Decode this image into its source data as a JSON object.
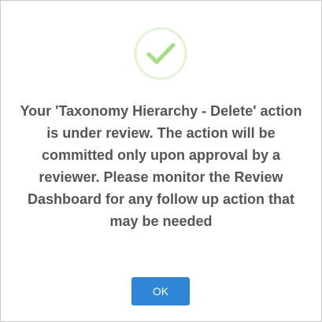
{
  "dialog": {
    "icon": "check-icon",
    "icon_color": "#a5dc86",
    "message": "Your 'Taxonomy Hierarchy - Delete' action is under review. The action will be committed only upon approval by a reviewer. Please monitor the Review Dashboard for any follow up action that may be needed",
    "ok_label": "OK",
    "accent_color": "#2f85d6"
  }
}
